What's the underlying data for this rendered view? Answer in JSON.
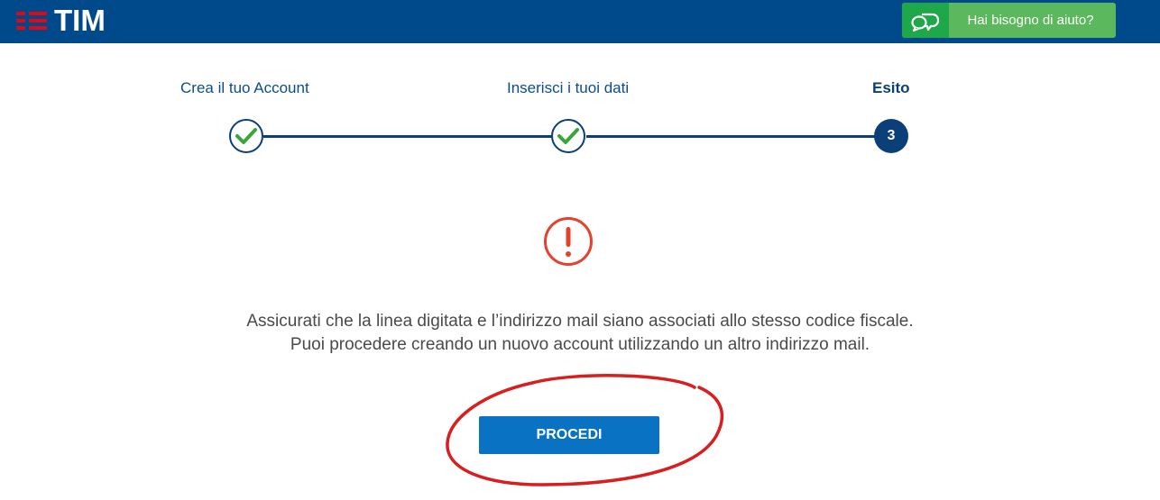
{
  "header": {
    "logo_text": "TIM",
    "help_label": "Hai bisogno di aiuto?"
  },
  "steps": [
    {
      "label": "Crea il tuo Account",
      "status": "completed"
    },
    {
      "label": "Inserisci i tuoi dati",
      "status": "completed"
    },
    {
      "label": "Esito",
      "status": "current",
      "number": "3"
    }
  ],
  "message": {
    "line1": "Assicurati che la linea digitata e l’indirizzo mail siano associati allo stesso codice fiscale.",
    "line2": "Puoi procedere creando un nuovo account utilizzando un altro indirizzo mail."
  },
  "action": {
    "proceed_label": "PROCEDI"
  },
  "colors": {
    "header_bg": "#004a8c",
    "brand_red": "#e30613",
    "help_green": "#5cb85c",
    "step_blue": "#0b3f78",
    "check_green": "#3aa63a",
    "alert_red": "#e4412e",
    "button_blue": "#0a72c2",
    "annotation_red": "#d81e1e"
  },
  "icons": [
    "tim-logo-icon",
    "chat-bubbles-icon",
    "check-icon",
    "alert-exclamation-icon"
  ]
}
